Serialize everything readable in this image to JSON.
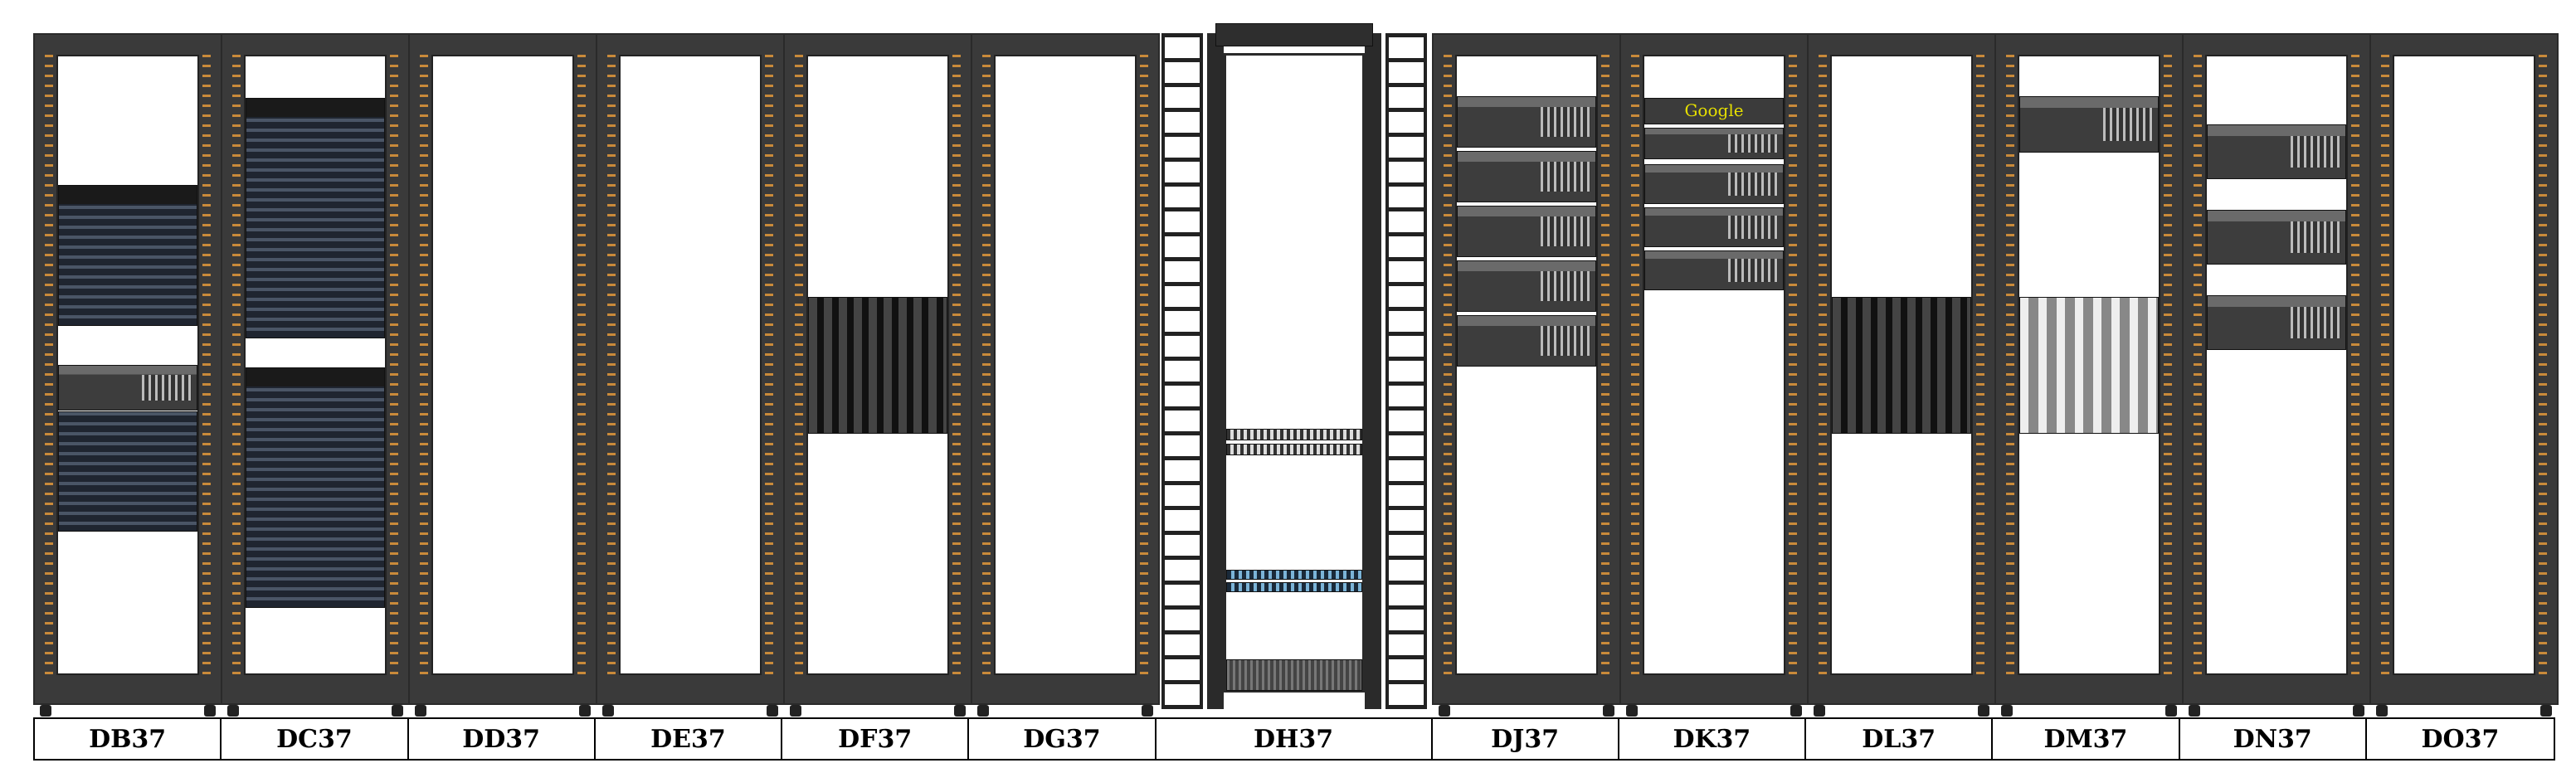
{
  "racks": [
    {
      "id": "DB37"
    },
    {
      "id": "DC37"
    },
    {
      "id": "DD37"
    },
    {
      "id": "DE37"
    },
    {
      "id": "DF37"
    },
    {
      "id": "DG37"
    },
    {
      "id": "DH37"
    },
    {
      "id": "DJ37"
    },
    {
      "id": "DK37"
    },
    {
      "id": "DL37"
    },
    {
      "id": "DM37"
    },
    {
      "id": "DN37"
    },
    {
      "id": "DO37"
    }
  ],
  "devices": {
    "DK37": {
      "brand_label": "Google"
    }
  },
  "colors": {
    "rack_frame": "#3a3a3a",
    "rail_holes": "#c98a3a",
    "label_border": "#000000"
  }
}
